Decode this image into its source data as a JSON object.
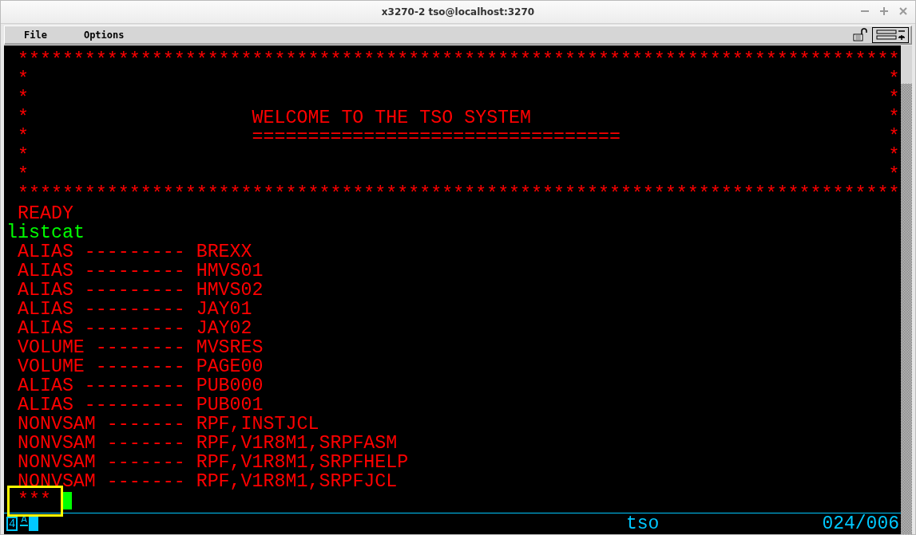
{
  "window": {
    "title": "x3270-2 tso@localhost:3270"
  },
  "menu": [
    {
      "label": "File"
    },
    {
      "label": "Options"
    }
  ],
  "banner": {
    "color": "#ff0000",
    "top_border": "*******************************************************************************",
    "rows": [
      {
        "left": "*",
        "right": "*"
      },
      {
        "left": "*",
        "right": "*"
      },
      {
        "left": "*",
        "text": "WELCOME TO THE TSO SYSTEM",
        "right": "*"
      },
      {
        "left": "*",
        "text": "=================================",
        "right": "*"
      },
      {
        "left": "*",
        "right": "*"
      },
      {
        "left": "*",
        "right": "*"
      }
    ],
    "bottom_border": "*******************************************************************************"
  },
  "lines": [
    {
      "kind": "output",
      "text": "READY",
      "color": "#ff0000"
    },
    {
      "kind": "input",
      "text": "listcat",
      "color": "#00ff00"
    },
    {
      "kind": "output",
      "text": "ALIAS --------- BREXX",
      "color": "#ff0000"
    },
    {
      "kind": "output",
      "text": "ALIAS --------- HMVS01",
      "color": "#ff0000"
    },
    {
      "kind": "output",
      "text": "ALIAS --------- HMVS02",
      "color": "#ff0000"
    },
    {
      "kind": "output",
      "text": "ALIAS --------- JAY01",
      "color": "#ff0000"
    },
    {
      "kind": "output",
      "text": "ALIAS --------- JAY02",
      "color": "#ff0000"
    },
    {
      "kind": "output",
      "text": "VOLUME -------- MVSRES",
      "color": "#ff0000"
    },
    {
      "kind": "output",
      "text": "VOLUME -------- PAGE00",
      "color": "#ff0000"
    },
    {
      "kind": "output",
      "text": "ALIAS --------- PUB000",
      "color": "#ff0000"
    },
    {
      "kind": "output",
      "text": "ALIAS --------- PUB001",
      "color": "#ff0000"
    },
    {
      "kind": "output",
      "text": "NONVSAM ------- RPF,INSTJCL",
      "color": "#ff0000"
    },
    {
      "kind": "output",
      "text": "NONVSAM ------- RPF,V1R8M1,SRPFASM",
      "color": "#ff0000"
    },
    {
      "kind": "output",
      "text": "NONVSAM ------- RPF,V1R8M1,SRPFHELP",
      "color": "#ff0000"
    },
    {
      "kind": "output",
      "text": "NONVSAM ------- RPF,V1R8M1,SRPFJCL",
      "color": "#ff0000"
    },
    {
      "kind": "output",
      "text": "***",
      "color": "#ff0000"
    }
  ],
  "status_line": {
    "connection": "4",
    "mode": "A",
    "host": "tso",
    "cursor_position": "024/006"
  },
  "annotation": {
    "kind": "highlight-box"
  }
}
